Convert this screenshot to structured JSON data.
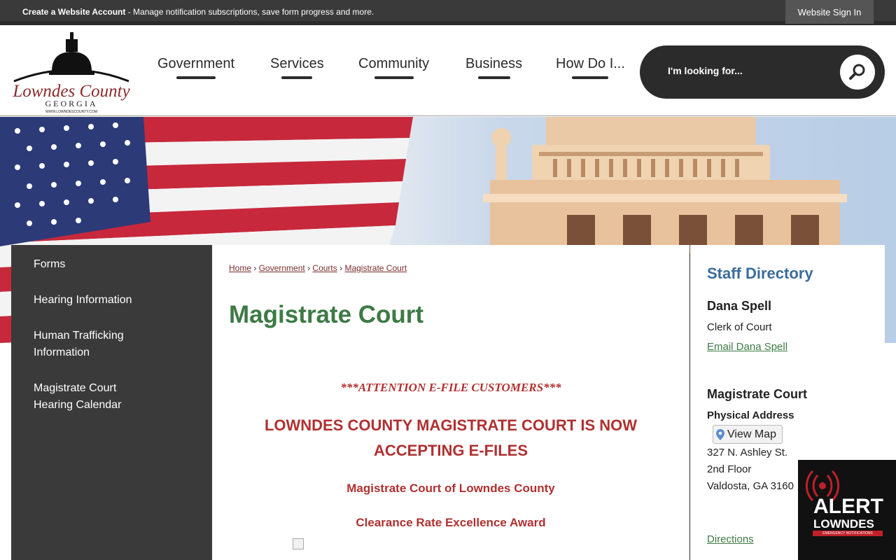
{
  "topbar": {
    "create_account_bold": "Create a Website Account",
    "create_account_rest": " - Manage notification subscriptions, save form progress and more.",
    "signin_label": "Website Sign In"
  },
  "logo": {
    "line1": "Lowndes County",
    "line2": "GEORGIA",
    "line3": "WWW.LOWNDESCOUNTY.COM"
  },
  "nav": {
    "items": [
      {
        "label": "Government"
      },
      {
        "label": "Services"
      },
      {
        "label": "Community"
      },
      {
        "label": "Business"
      },
      {
        "label": "How Do I..."
      }
    ]
  },
  "search": {
    "placeholder": "I'm looking for..."
  },
  "sidebar": {
    "items": [
      {
        "label": "Forms"
      },
      {
        "label": "Hearing Information"
      },
      {
        "label": "Human Trafficking Information"
      },
      {
        "label": "Magistrate Court Hearing Calendar"
      }
    ]
  },
  "breadcrumb": {
    "home": "Home",
    "government": "Government",
    "courts": "Courts",
    "current": "Magistrate Court",
    "sep": "›"
  },
  "main": {
    "title": "Magistrate Court",
    "attention": "***ATTENTION E-FILE CUSTOMERS***",
    "announce": "LOWNDES COUNTY MAGISTRATE COURT IS NOW ACCEPTING E-FILES",
    "sub1": "Magistrate Court of Lowndes County",
    "sub2": "Clearance Rate Excellence Award"
  },
  "staff": {
    "title": "Staff Directory",
    "name": "Dana Spell",
    "role": "Clerk of Court",
    "email_link": "Email Dana Spell"
  },
  "location": {
    "name": "Magistrate Court",
    "physical_label": "Physical Address",
    "view_map": "View Map",
    "address1": "327 N. Ashley St.",
    "address2": "2nd Floor",
    "address3": "Valdosta, GA 3160",
    "directions": "Directions"
  },
  "alert": {
    "line1": "ALERT",
    "line2": "LOWNDES",
    "line3": "EMERGENCY NOTIFICATIONS"
  },
  "colors": {
    "dark_bar": "#3a3a3a",
    "title_green": "#3d7a44",
    "announce_red": "#b03030",
    "staff_blue": "#3a6c9c",
    "link_maroon": "#7b2d2d"
  }
}
